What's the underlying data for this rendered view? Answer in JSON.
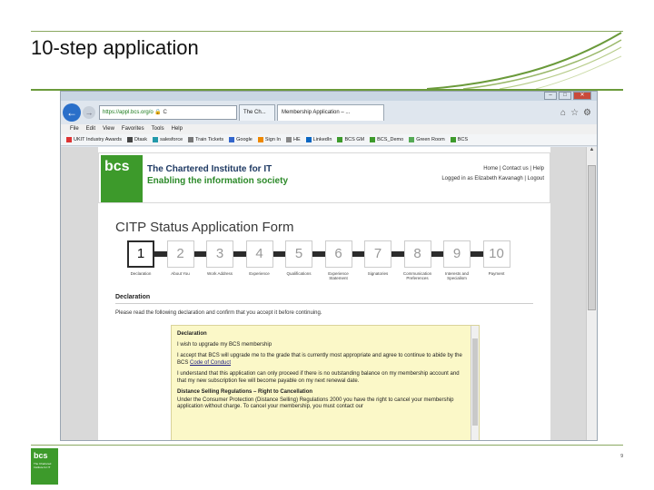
{
  "slide": {
    "title": "10-step application",
    "page_number": "9"
  },
  "browser": {
    "address": "https://appl.bcs.org/o",
    "tabs": [
      "The Ch...",
      "Membership Application – ..."
    ],
    "menu": [
      "File",
      "Edit",
      "View",
      "Favorites",
      "Tools",
      "Help"
    ],
    "favorites": [
      "UKIT Industry Awards",
      "Dtask",
      "salesforce",
      "Train Tickets",
      "Google",
      "Sign In",
      "HE",
      "LinkedIn",
      "BCS GM",
      "BCS_Demo",
      "Green Room",
      "BCS"
    ]
  },
  "header": {
    "logo_text": "bcs",
    "org_name": "The Chartered Institute for IT",
    "tagline": "Enabling the information society",
    "links": "Home | Contact us | Help",
    "logged_in": "Logged in as Elizabeth Kavanagh | Logout"
  },
  "form": {
    "title": "CITP Status Application Form",
    "steps": [
      {
        "num": "1",
        "label": "Declaration"
      },
      {
        "num": "2",
        "label": "About You"
      },
      {
        "num": "3",
        "label": "Work Address"
      },
      {
        "num": "4",
        "label": "Experience"
      },
      {
        "num": "5",
        "label": "Qualifications"
      },
      {
        "num": "6",
        "label": "Experience Statement"
      },
      {
        "num": "7",
        "label": "Signatories"
      },
      {
        "num": "8",
        "label": "Communication Preferences"
      },
      {
        "num": "9",
        "label": "Interests and Specialism"
      },
      {
        "num": "10",
        "label": "Payment"
      }
    ],
    "active_step": 1,
    "section_heading": "Declaration",
    "instruction": "Please read the following declaration and confirm that you accept it before continuing.",
    "declaration": {
      "heading": "Declaration",
      "p1": "I wish to upgrade my BCS membership",
      "p2": "I accept that BCS will upgrade me to the grade that is currently most appropriate and agree to continue to abide by the BCS",
      "code_link": "Code of Conduct",
      "p3": "I understand that this application can only proceed if there is no outstanding balance on my membership account and that my new subscription fee will become payable on my next renewal date.",
      "p4_heading": "Distance Selling Regulations – Right to Cancellation",
      "p4": "Under the Consumer Protection (Distance Selling) Regulations 2000 you have the right to cancel your membership application without charge. To cancel your membership, you must contact our"
    }
  },
  "footer": {
    "logo_text": "bcs",
    "logo_small": "The Chartered Institute for IT"
  },
  "colors": {
    "bcs_green": "#3d9a2b",
    "navy": "#1f3a63",
    "decl_bg": "#fbf8c8"
  }
}
